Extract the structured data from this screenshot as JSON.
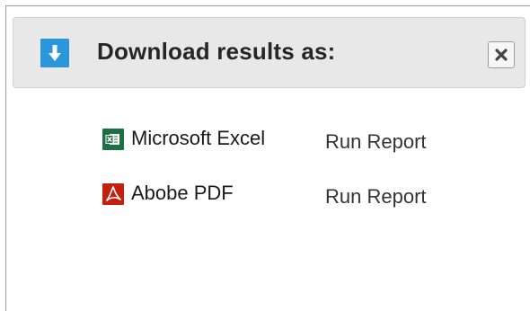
{
  "dialog": {
    "title": "Download results as:",
    "title_icon": "download-arrow-icon",
    "close_icon": "close-x-icon"
  },
  "options": [
    {
      "label": "Microsoft Excel",
      "icon": "excel-icon",
      "icon_color": "#1d7044",
      "action_label": "Run Report"
    },
    {
      "label": "Abobe PDF",
      "icon": "pdf-icon",
      "icon_color": "#c4200e",
      "action_label": "Run Report"
    }
  ],
  "colors": {
    "accent": "#2a97dd",
    "header_bg": "#e8e8e8"
  }
}
